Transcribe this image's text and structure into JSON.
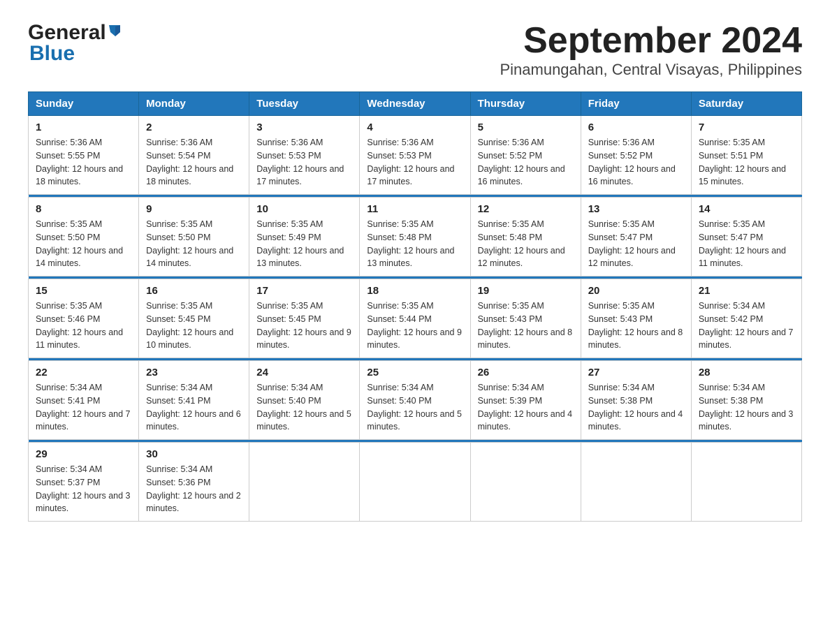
{
  "logo": {
    "general": "General",
    "blue": "Blue"
  },
  "title": "September 2024",
  "subtitle": "Pinamungahan, Central Visayas, Philippines",
  "days": [
    "Sunday",
    "Monday",
    "Tuesday",
    "Wednesday",
    "Thursday",
    "Friday",
    "Saturday"
  ],
  "weeks": [
    [
      {
        "num": "1",
        "sunrise": "5:36 AM",
        "sunset": "5:55 PM",
        "daylight": "12 hours and 18 minutes."
      },
      {
        "num": "2",
        "sunrise": "5:36 AM",
        "sunset": "5:54 PM",
        "daylight": "12 hours and 18 minutes."
      },
      {
        "num": "3",
        "sunrise": "5:36 AM",
        "sunset": "5:53 PM",
        "daylight": "12 hours and 17 minutes."
      },
      {
        "num": "4",
        "sunrise": "5:36 AM",
        "sunset": "5:53 PM",
        "daylight": "12 hours and 17 minutes."
      },
      {
        "num": "5",
        "sunrise": "5:36 AM",
        "sunset": "5:52 PM",
        "daylight": "12 hours and 16 minutes."
      },
      {
        "num": "6",
        "sunrise": "5:36 AM",
        "sunset": "5:52 PM",
        "daylight": "12 hours and 16 minutes."
      },
      {
        "num": "7",
        "sunrise": "5:35 AM",
        "sunset": "5:51 PM",
        "daylight": "12 hours and 15 minutes."
      }
    ],
    [
      {
        "num": "8",
        "sunrise": "5:35 AM",
        "sunset": "5:50 PM",
        "daylight": "12 hours and 14 minutes."
      },
      {
        "num": "9",
        "sunrise": "5:35 AM",
        "sunset": "5:50 PM",
        "daylight": "12 hours and 14 minutes."
      },
      {
        "num": "10",
        "sunrise": "5:35 AM",
        "sunset": "5:49 PM",
        "daylight": "12 hours and 13 minutes."
      },
      {
        "num": "11",
        "sunrise": "5:35 AM",
        "sunset": "5:48 PM",
        "daylight": "12 hours and 13 minutes."
      },
      {
        "num": "12",
        "sunrise": "5:35 AM",
        "sunset": "5:48 PM",
        "daylight": "12 hours and 12 minutes."
      },
      {
        "num": "13",
        "sunrise": "5:35 AM",
        "sunset": "5:47 PM",
        "daylight": "12 hours and 12 minutes."
      },
      {
        "num": "14",
        "sunrise": "5:35 AM",
        "sunset": "5:47 PM",
        "daylight": "12 hours and 11 minutes."
      }
    ],
    [
      {
        "num": "15",
        "sunrise": "5:35 AM",
        "sunset": "5:46 PM",
        "daylight": "12 hours and 11 minutes."
      },
      {
        "num": "16",
        "sunrise": "5:35 AM",
        "sunset": "5:45 PM",
        "daylight": "12 hours and 10 minutes."
      },
      {
        "num": "17",
        "sunrise": "5:35 AM",
        "sunset": "5:45 PM",
        "daylight": "12 hours and 9 minutes."
      },
      {
        "num": "18",
        "sunrise": "5:35 AM",
        "sunset": "5:44 PM",
        "daylight": "12 hours and 9 minutes."
      },
      {
        "num": "19",
        "sunrise": "5:35 AM",
        "sunset": "5:43 PM",
        "daylight": "12 hours and 8 minutes."
      },
      {
        "num": "20",
        "sunrise": "5:35 AM",
        "sunset": "5:43 PM",
        "daylight": "12 hours and 8 minutes."
      },
      {
        "num": "21",
        "sunrise": "5:34 AM",
        "sunset": "5:42 PM",
        "daylight": "12 hours and 7 minutes."
      }
    ],
    [
      {
        "num": "22",
        "sunrise": "5:34 AM",
        "sunset": "5:41 PM",
        "daylight": "12 hours and 7 minutes."
      },
      {
        "num": "23",
        "sunrise": "5:34 AM",
        "sunset": "5:41 PM",
        "daylight": "12 hours and 6 minutes."
      },
      {
        "num": "24",
        "sunrise": "5:34 AM",
        "sunset": "5:40 PM",
        "daylight": "12 hours and 5 minutes."
      },
      {
        "num": "25",
        "sunrise": "5:34 AM",
        "sunset": "5:40 PM",
        "daylight": "12 hours and 5 minutes."
      },
      {
        "num": "26",
        "sunrise": "5:34 AM",
        "sunset": "5:39 PM",
        "daylight": "12 hours and 4 minutes."
      },
      {
        "num": "27",
        "sunrise": "5:34 AM",
        "sunset": "5:38 PM",
        "daylight": "12 hours and 4 minutes."
      },
      {
        "num": "28",
        "sunrise": "5:34 AM",
        "sunset": "5:38 PM",
        "daylight": "12 hours and 3 minutes."
      }
    ],
    [
      {
        "num": "29",
        "sunrise": "5:34 AM",
        "sunset": "5:37 PM",
        "daylight": "12 hours and 3 minutes."
      },
      {
        "num": "30",
        "sunrise": "5:34 AM",
        "sunset": "5:36 PM",
        "daylight": "12 hours and 2 minutes."
      },
      null,
      null,
      null,
      null,
      null
    ]
  ]
}
